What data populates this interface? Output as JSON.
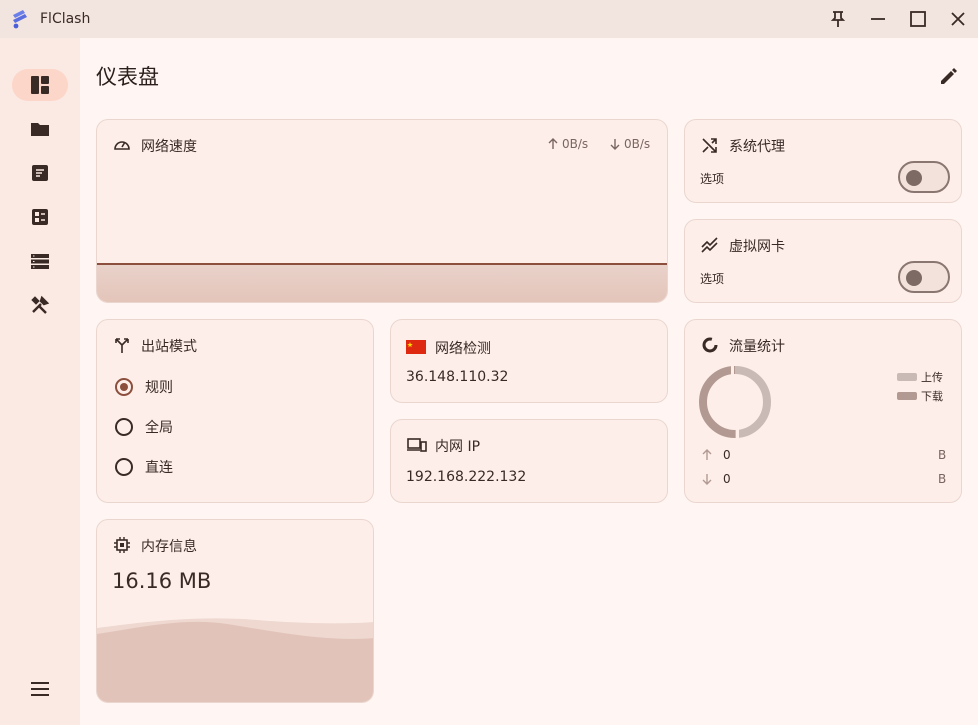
{
  "app": {
    "title": "FlClash"
  },
  "page": {
    "title": "仪表盘"
  },
  "network_speed": {
    "title": "网络速度",
    "upload": "0B/s",
    "download": "0B/s"
  },
  "system_proxy": {
    "title": "系统代理",
    "option_label": "选项",
    "enabled": false
  },
  "virtual_nic": {
    "title": "虚拟网卡",
    "option_label": "选项",
    "enabled": false
  },
  "outbound_mode": {
    "title": "出站模式",
    "options": [
      {
        "label": "规则",
        "selected": true
      },
      {
        "label": "全局",
        "selected": false
      },
      {
        "label": "直连",
        "selected": false
      }
    ]
  },
  "network_check": {
    "title": "网络检测",
    "ip": "36.148.110.32"
  },
  "lan_ip": {
    "title": "内网 IP",
    "ip": "192.168.222.132"
  },
  "traffic_stats": {
    "title": "流量统计",
    "legend_upload": "上传",
    "legend_download": "下载",
    "upload_value": "0",
    "upload_unit": "B",
    "download_value": "0",
    "download_unit": "B"
  },
  "memory": {
    "title": "内存信息",
    "value": "16.16 MB"
  },
  "colors": {
    "accent": "#8c4f3d",
    "sidebar_active": "#fcd6c8",
    "card_bg": "#fdeeea"
  }
}
